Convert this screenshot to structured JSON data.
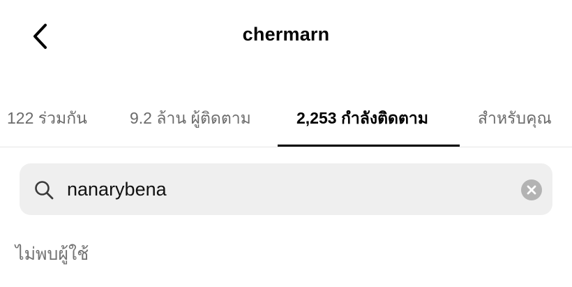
{
  "header": {
    "title": "chermarn",
    "back_icon": "chevron-left-icon"
  },
  "tabs": [
    {
      "label": "122 ร่วมกัน",
      "active": false
    },
    {
      "label": "9.2 ล้าน ผู้ติดตาม",
      "active": false
    },
    {
      "label": "2,253 กำลังติดตาม",
      "active": true
    },
    {
      "label": "สำหรับคุณ",
      "active": false
    }
  ],
  "search": {
    "value": "nanarybena",
    "icon": "search-icon",
    "clear_icon": "clear-circle-icon"
  },
  "results": {
    "empty_message": "ไม่พบผู้ใช้"
  },
  "colors": {
    "active_tab": "#000000",
    "inactive_tab": "#6b6b6b",
    "search_background": "#efefef",
    "muted_text": "#737373"
  }
}
